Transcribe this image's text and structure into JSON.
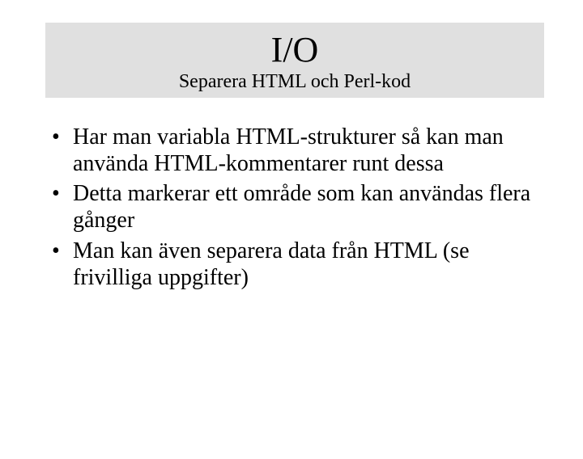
{
  "title": {
    "main": "I/O",
    "sub": "Separera HTML och Perl-kod"
  },
  "bullets": [
    "Har man variabla HTML-strukturer så kan man använda HTML-kommentarer runt dessa",
    "Detta markerar ett område som kan användas flera gånger",
    "Man kan även separera data från HTML (se frivilliga uppgifter)"
  ]
}
